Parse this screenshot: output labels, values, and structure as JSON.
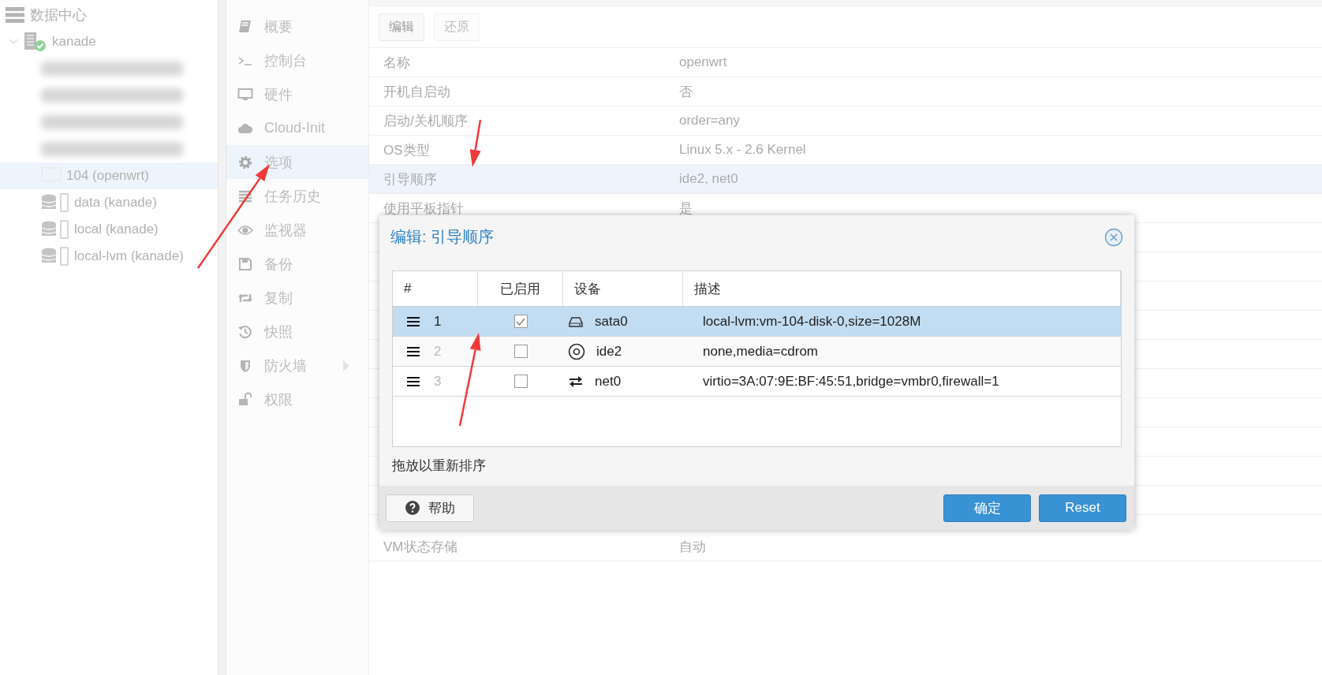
{
  "tree": {
    "label": "数据中心",
    "children": [
      {
        "kind": "node",
        "label": "kanade",
        "expanded": true,
        "children": [
          {
            "kind": "blurred",
            "selected": false
          },
          {
            "kind": "blurred",
            "selected": false
          },
          {
            "kind": "blurred",
            "selected": false
          },
          {
            "kind": "blurred",
            "selected": false
          },
          {
            "kind": "vm",
            "label": "104 (openwrt)",
            "selected": true
          },
          {
            "kind": "storage",
            "label": "data (kanade)",
            "selected": false
          },
          {
            "kind": "storage",
            "label": "local (kanade)",
            "selected": false
          },
          {
            "kind": "storage",
            "label": "local-lvm (kanade)",
            "selected": false
          }
        ]
      }
    ]
  },
  "nav": {
    "items": [
      {
        "label": "概要",
        "selected": false,
        "has_submenu": false
      },
      {
        "label": "控制台",
        "selected": false,
        "has_submenu": false
      },
      {
        "label": "硬件",
        "selected": false,
        "has_submenu": false
      },
      {
        "label": "Cloud-Init",
        "selected": false,
        "has_submenu": false
      },
      {
        "label": "选项",
        "selected": true,
        "has_submenu": false
      },
      {
        "label": "任务历史",
        "selected": false,
        "has_submenu": false
      },
      {
        "label": "监视器",
        "selected": false,
        "has_submenu": false
      },
      {
        "label": "备份",
        "selected": false,
        "has_submenu": false
      },
      {
        "label": "复制",
        "selected": false,
        "has_submenu": false
      },
      {
        "label": "快照",
        "selected": false,
        "has_submenu": false
      },
      {
        "label": "防火墙",
        "selected": false,
        "has_submenu": true
      },
      {
        "label": "权限",
        "selected": false,
        "has_submenu": false
      }
    ]
  },
  "content": {
    "toolbar": [
      {
        "label": "编辑",
        "disabled": false
      },
      {
        "label": "还原",
        "disabled": true
      }
    ],
    "rows": [
      {
        "label": "名称",
        "value": "openwrt",
        "selected": false
      },
      {
        "label": "开机自启动",
        "value": "否",
        "selected": false
      },
      {
        "label": "启动/关机顺序",
        "value": "order=any",
        "selected": false
      },
      {
        "label": "OS类型",
        "value": "Linux 5.x - 2.6 Kernel",
        "selected": false
      },
      {
        "label": "引导顺序",
        "value": "ide2, net0",
        "selected": true
      },
      {
        "label": "使用平板指针",
        "value": "是",
        "selected": false
      }
    ],
    "rows_after_dialog": [
      {
        "label": "VM状态存储",
        "value": "自动",
        "selected": false
      }
    ]
  },
  "dialog": {
    "title": "编辑: 引导顺序",
    "columns": [
      "#",
      "已启用",
      "设备",
      "描述"
    ],
    "rows": [
      {
        "number": "1",
        "enabled": true,
        "selected": true,
        "kind": "disk",
        "device": "sata0",
        "description": "local-lvm:vm-104-disk-0,size=1028M"
      },
      {
        "number": "2",
        "enabled": false,
        "selected": false,
        "kind": "cdrom",
        "device": "ide2",
        "description": "none,media=cdrom"
      },
      {
        "number": "3",
        "enabled": false,
        "selected": false,
        "kind": "net",
        "device": "net0",
        "description": "virtio=3A:07:9E:BF:45:51,bridge=vmbr0,firewall=1"
      }
    ],
    "hint": "拖放以重新排序",
    "buttons": [
      {
        "kind": "help",
        "label": "帮助"
      },
      {
        "kind": "primary",
        "label": "确定"
      },
      {
        "kind": "primary",
        "label": "Reset"
      }
    ]
  }
}
